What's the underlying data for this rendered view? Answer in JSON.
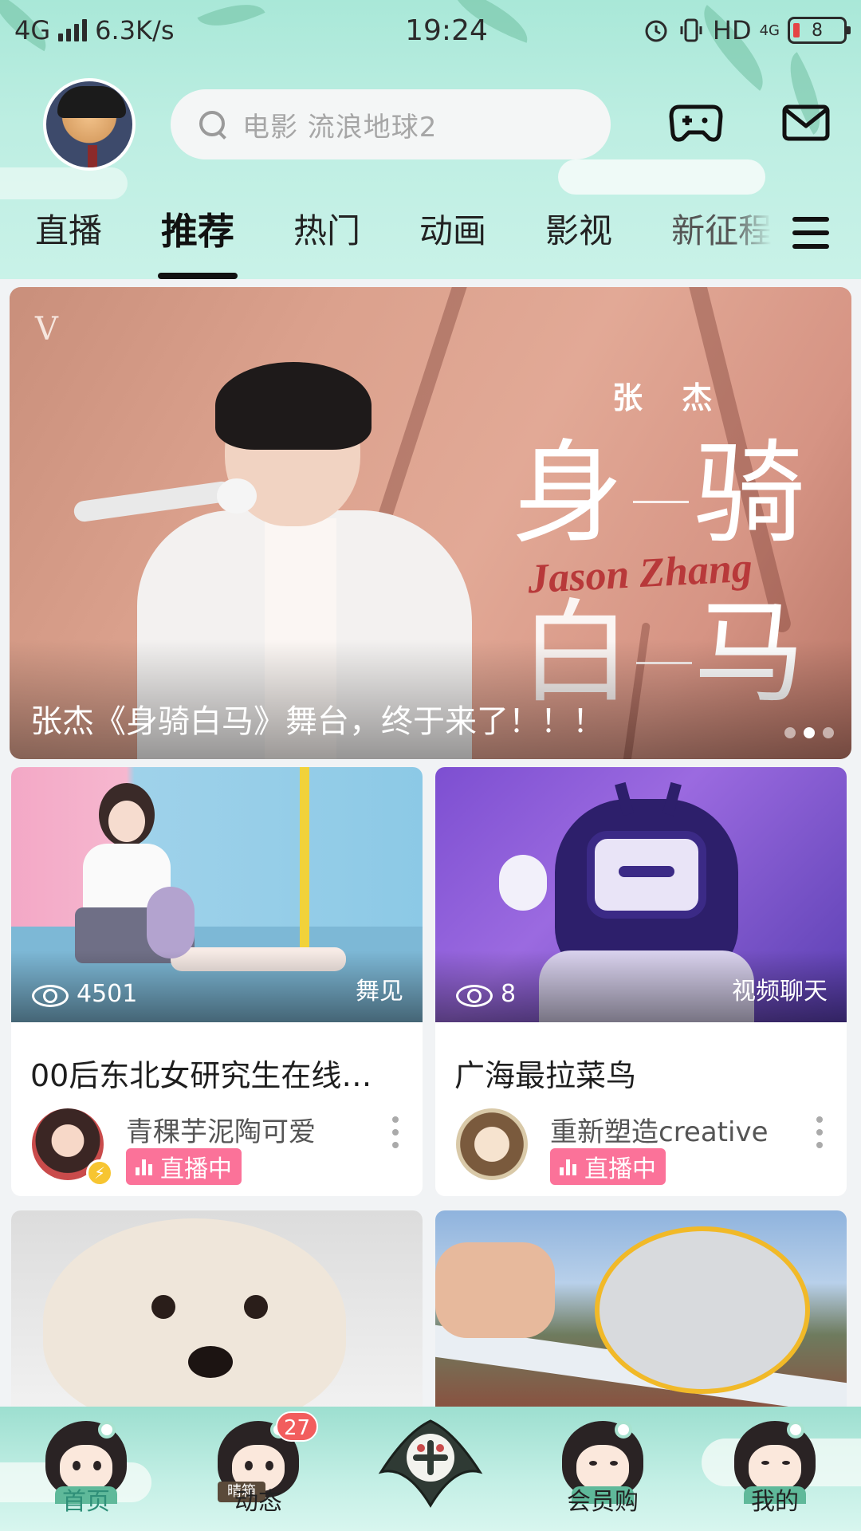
{
  "status_bar": {
    "network": "4G",
    "speed": "6.3K/s",
    "time": "19:24",
    "hd": "HD",
    "net_small": "4G",
    "battery": "8"
  },
  "header": {
    "search_placeholder": "电影 流浪地球2",
    "tabs": [
      "直播",
      "推荐",
      "热门",
      "动画",
      "影视",
      "新征程"
    ],
    "active_tab": "推荐"
  },
  "banner": {
    "artist": "张 杰",
    "title_chars": [
      "身",
      "骑",
      "白",
      "马"
    ],
    "script": "Jason Zhang",
    "caption": "张杰《身骑白马》舞台，终于来了！！！",
    "logo": "V"
  },
  "cards": [
    {
      "views": "4501",
      "area": "舞见",
      "title": "00后东北女研究生在线…",
      "uploader": "青稞芋泥陶可爱",
      "status": "直播中"
    },
    {
      "views": "8",
      "area": "视频聊天",
      "title": "广海最拉菜鸟",
      "uploader": "重新塑造creative",
      "status": "直播中"
    }
  ],
  "bottom_nav": {
    "items": [
      {
        "label": "首页",
        "active": true
      },
      {
        "label": "动态",
        "badge": "27"
      },
      {
        "label": "会员购"
      },
      {
        "label": "我的"
      }
    ],
    "mascot_sign": "晴箱"
  },
  "colors": {
    "theme_mint": "#bdeee2",
    "live_pink": "#fb7299",
    "active_nav": "#2f8f78"
  }
}
